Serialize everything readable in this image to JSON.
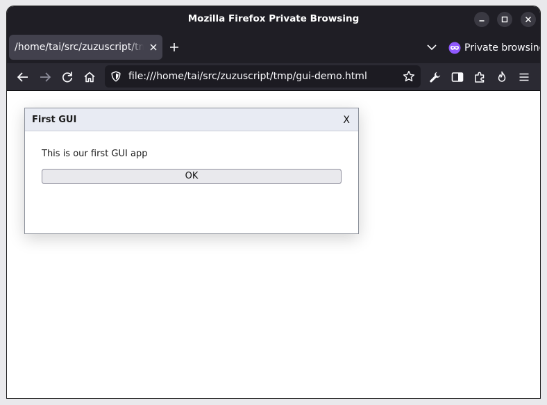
{
  "window": {
    "title": "Mozilla Firefox Private Browsing",
    "controls": [
      "minimize-icon",
      "maximize-icon",
      "close-icon"
    ]
  },
  "tabs": [
    {
      "label": "/home/tai/src/zuzuscript/tmp/gui-demo.html",
      "active": true
    }
  ],
  "private_mode": {
    "label": "Private browsing",
    "icon": "private-mask-icon",
    "color": "#9059ff"
  },
  "navbar": {
    "url": "file:///home/tai/src/zuzuscript/tmp/gui-demo.html",
    "buttons": [
      "back-icon",
      "forward-icon",
      "reload-icon",
      "home-icon"
    ],
    "right_buttons": [
      "wrench-icon",
      "sidebar-icon",
      "extensions-icon",
      "firefox-view-icon",
      "menu-icon"
    ]
  },
  "dialog": {
    "title": "First GUI",
    "close_label": "X",
    "message": "This is our first GUI app",
    "ok_label": "OK"
  },
  "colors": {
    "titlebar": "#1f1e25",
    "tab_active": "#42414d",
    "toolbar": "#2b2a33",
    "urlbar": "#1c1b22",
    "dialog_header": "#e8ebf3"
  }
}
